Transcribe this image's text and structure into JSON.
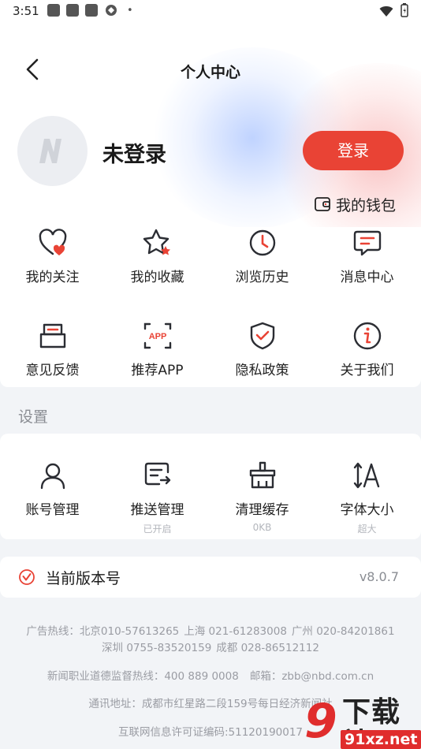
{
  "status_bar": {
    "time": "3:51"
  },
  "header": {
    "title": "个人中心"
  },
  "profile": {
    "username": "未登录",
    "login_label": "登录",
    "wallet_label": "我的钱包"
  },
  "quick_menu": [
    {
      "icon": "heart-icon",
      "label": "我的关注"
    },
    {
      "icon": "star-icon",
      "label": "我的收藏"
    },
    {
      "icon": "clock-icon",
      "label": "浏览历史"
    },
    {
      "icon": "message-icon",
      "label": "消息中心"
    },
    {
      "icon": "feedback-icon",
      "label": "意见反馈"
    },
    {
      "icon": "app-icon",
      "label": "推荐APP"
    },
    {
      "icon": "shield-check-icon",
      "label": "隐私政策"
    },
    {
      "icon": "info-icon",
      "label": "关于我们"
    }
  ],
  "settings": {
    "title": "设置",
    "items": [
      {
        "icon": "user-icon",
        "label": "账号管理",
        "sub": ""
      },
      {
        "icon": "push-icon",
        "label": "推送管理",
        "sub": "已开启"
      },
      {
        "icon": "broom-icon",
        "label": "清理缓存",
        "sub": "0KB"
      },
      {
        "icon": "font-size-icon",
        "label": "字体大小",
        "sub": "超大"
      }
    ]
  },
  "version": {
    "label": "当前版本号",
    "value": "v8.0.7"
  },
  "footer": {
    "line1": [
      "广告热线：北京010-57613265",
      "上海 021-61283008",
      "广州 020-84201861"
    ],
    "line2": [
      "深圳 0755-83520159",
      "成都 028-86512112"
    ],
    "line3": [
      "新闻职业道德监督热线：400 889 0008",
      "邮箱：zbb@nbd.com.cn"
    ],
    "line4": "通讯地址：成都市红星路二段159号每日经济新闻社",
    "line5": "互联网信息许可证编码:51120190017"
  },
  "watermark": {
    "title": "下载站",
    "domain": "91xz.net"
  },
  "colors": {
    "accent": "#e94335",
    "page_bg": "#f2f4f7",
    "icon_stroke": "#2b2d33"
  }
}
